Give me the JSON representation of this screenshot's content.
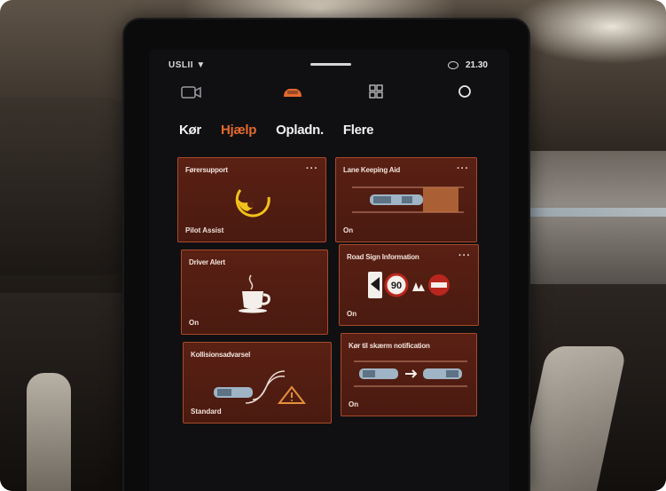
{
  "status_bar": {
    "left_text": "USLII ▼",
    "time": "21.30"
  },
  "icons": {
    "camera": "camera-icon",
    "car": "car-icon",
    "apps": "grid-icon",
    "profile": "profile-icon",
    "wifi": "wifi-icon"
  },
  "tabs": [
    {
      "label": "Kør",
      "active": false
    },
    {
      "label": "Hjælp",
      "active": true
    },
    {
      "label": "Opladn.",
      "active": false
    },
    {
      "label": "Flere",
      "active": false
    }
  ],
  "tiles": [
    {
      "title": "Førersupport",
      "status": "Pilot Assist",
      "has_more": true,
      "icon": "steering-assist-icon"
    },
    {
      "title": "Lane Keeping Aid",
      "status": "On",
      "has_more": true,
      "icon": "lane-keeping-icon"
    },
    {
      "title": "Driver Alert",
      "status": "On",
      "has_more": false,
      "icon": "coffee-cup-icon"
    },
    {
      "title": "Road Sign Information",
      "status": "On",
      "has_more": true,
      "icon": "road-sign-icon",
      "speed_value": "90"
    },
    {
      "title": "Kollisionsadvarsel",
      "status": "Standard",
      "has_more": false,
      "icon": "collision-warning-icon"
    },
    {
      "title": "Kør til skærm notification",
      "status": "On",
      "has_more": false,
      "icon": "drive-off-notification-icon"
    }
  ],
  "colors": {
    "accent": "#e46a2e",
    "tile_bg": "#4f1c11",
    "tile_border": "#a84a2a",
    "screen_bg": "#101012"
  }
}
